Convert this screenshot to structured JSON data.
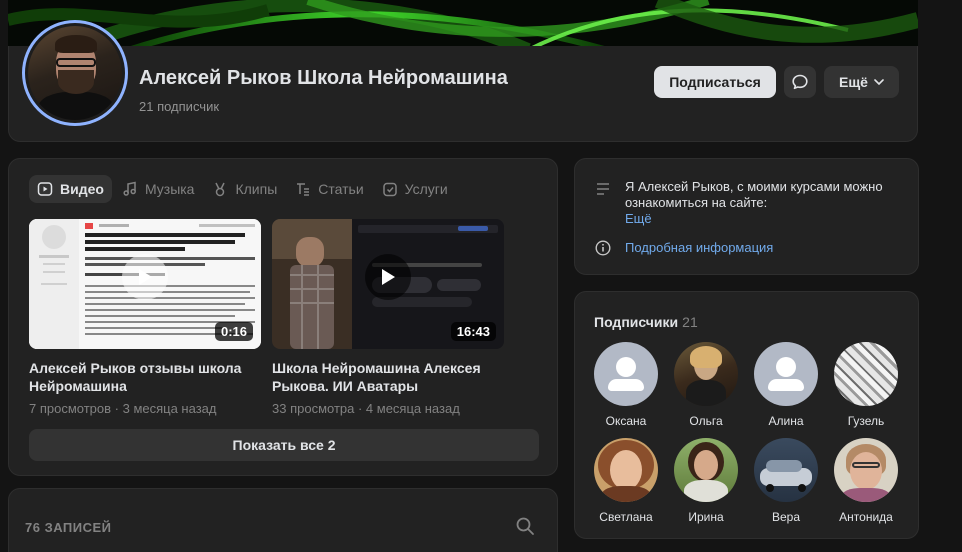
{
  "profile": {
    "name": "Алексей Рыков Школа Нейромашина",
    "subscribers": "21 подписчик",
    "subscribe_label": "Подписаться",
    "more_label": "Ещё"
  },
  "media": {
    "tabs": [
      {
        "label": "Видео",
        "icon": "video-icon",
        "active": true
      },
      {
        "label": "Музыка",
        "icon": "music-icon",
        "active": false
      },
      {
        "label": "Клипы",
        "icon": "clips-icon",
        "active": false
      },
      {
        "label": "Статьи",
        "icon": "articles-icon",
        "active": false
      },
      {
        "label": "Услуги",
        "icon": "services-icon",
        "active": false
      }
    ],
    "videos": [
      {
        "title": "Алексей Рыков отзывы школа Нейромашина",
        "meta": "7 просмотров · 3 месяца назад",
        "duration": "0:16"
      },
      {
        "title": "Школа Нейромашина Алексея Рыкова. ИИ Аватары",
        "meta": "33 просмотра · 4 месяца назад",
        "duration": "16:43"
      }
    ],
    "show_all_label": "Показать все 2"
  },
  "posts": {
    "count_label": "76 ЗАПИСЕЙ"
  },
  "info": {
    "description": "Я Алексей Рыков, с моими курсами можно ознакомиться на сайте:",
    "more_link": "Ещё",
    "details_link": "Подробная информация"
  },
  "subscribers": {
    "title": "Подписчики",
    "count": "21",
    "items": [
      {
        "name": "Оксана",
        "photo": "default"
      },
      {
        "name": "Ольга",
        "photo": "photo"
      },
      {
        "name": "Алина",
        "photo": "default"
      },
      {
        "name": "Гузель",
        "photo": "photo"
      },
      {
        "name": "Светлана",
        "photo": "photo"
      },
      {
        "name": "Ирина",
        "photo": "photo"
      },
      {
        "name": "Вера",
        "photo": "photo"
      },
      {
        "name": "Антонида",
        "photo": "photo"
      }
    ]
  },
  "colors": {
    "background": "#141414",
    "card": "#222222",
    "link": "#71aaeb",
    "avatar_ring": "#8fb3ff",
    "cover_green": "#3fd62a"
  }
}
